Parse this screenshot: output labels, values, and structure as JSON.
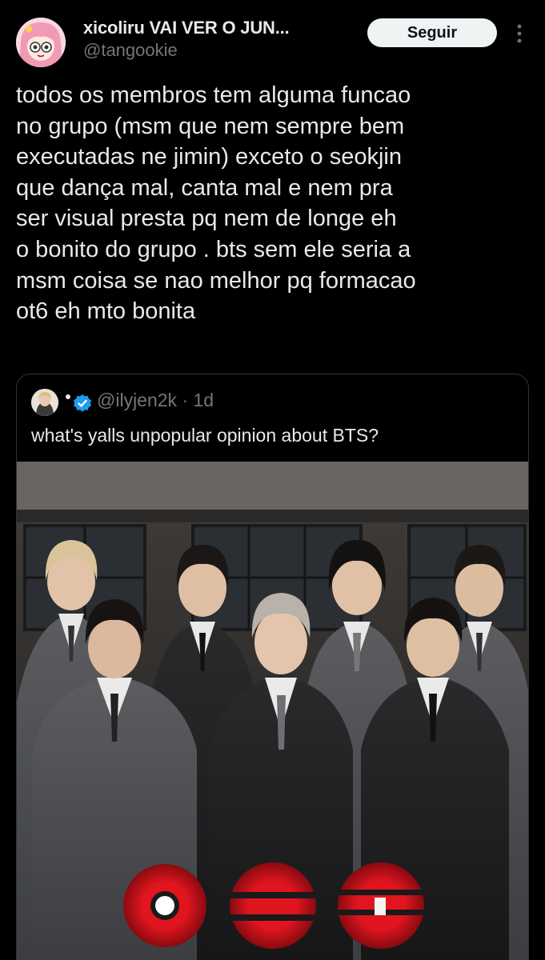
{
  "author": {
    "display_name": "xicoliru VAI VER O JUN...",
    "handle": "@tangookie",
    "avatar_icon": "profile-avatar",
    "follow_label": "Seguir",
    "more_icon": "more-options-icon"
  },
  "tweet": {
    "text": "todos os membros tem alguma funcao\nno grupo (msm que nem sempre bem\nexecutadas ne jimin) exceto o seokjin\nque dança mal, canta mal e nem pra\nser visual presta pq nem de longe eh\no bonito do grupo . bts sem ele seria a\nmsm coisa se nao melhor pq formacao\not6 eh mto bonita"
  },
  "quote": {
    "handle": "@ilyjen2k",
    "separator": "·",
    "time": "1d",
    "text": "what's yalls unpopular opinion about BTS?",
    "verified_color": "#1d9bf0",
    "media_alt_icon": "group-photo"
  },
  "colors": {
    "background": "#000000",
    "text": "#e7e9ea",
    "muted": "#71767b",
    "border": "#2f3336",
    "accent_red": "#e0151f"
  }
}
